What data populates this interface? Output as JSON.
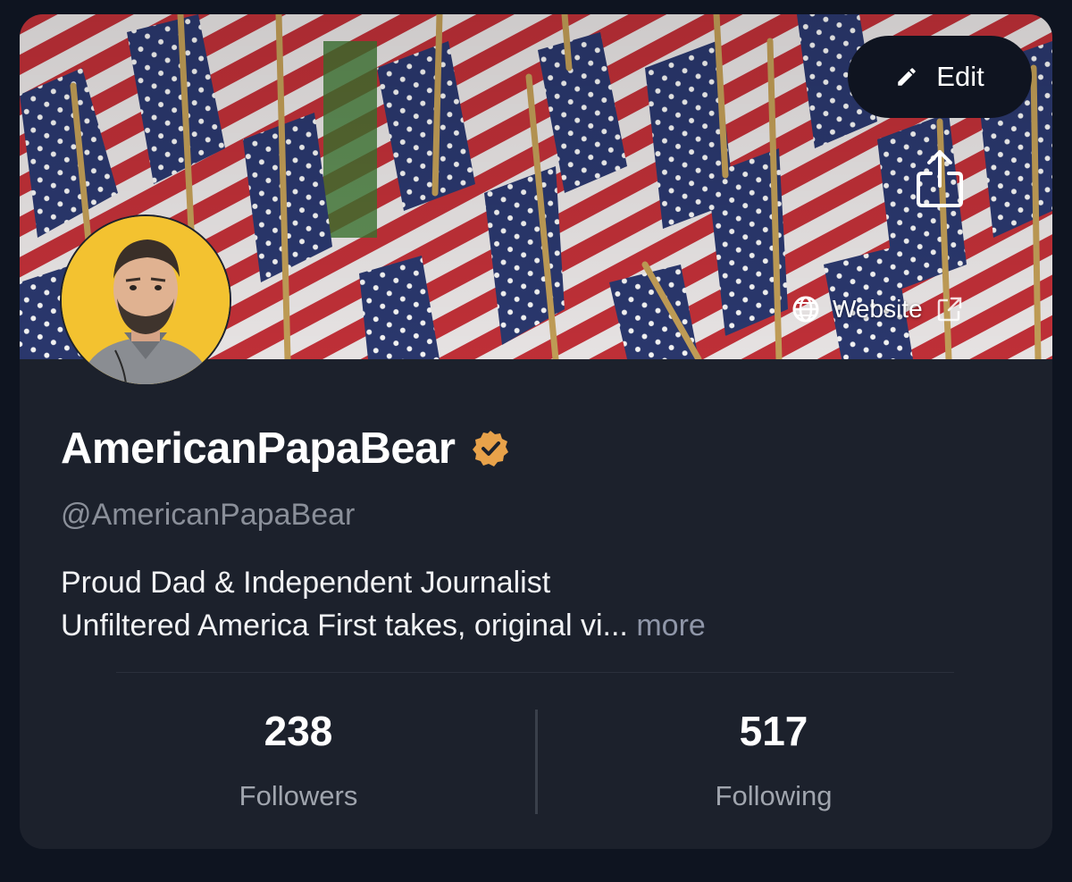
{
  "profile": {
    "display_name": "AmericanPapaBear",
    "handle": "@AmericanPapaBear",
    "verified_badge": "verified-badge-icon",
    "badge_color": "#e8a24a",
    "bio_line1": "Proud Dad & Independent Journalist",
    "bio_line2": "Unfiltered America First takes, original vi...",
    "more_label": "more"
  },
  "header": {
    "edit_label": "Edit",
    "edit_icon": "pencil-icon",
    "share_icon": "share-icon",
    "website_label": "Website",
    "website_icon": "globe-icon",
    "external_icon": "external-link-icon"
  },
  "stats": {
    "followers_count": "238",
    "followers_label": "Followers",
    "following_count": "517",
    "following_label": "Following"
  },
  "colors": {
    "card_bg": "#1c212c",
    "page_bg": "#0e1420",
    "accent_badge": "#e8a24a",
    "muted_text": "#8a8f99"
  }
}
